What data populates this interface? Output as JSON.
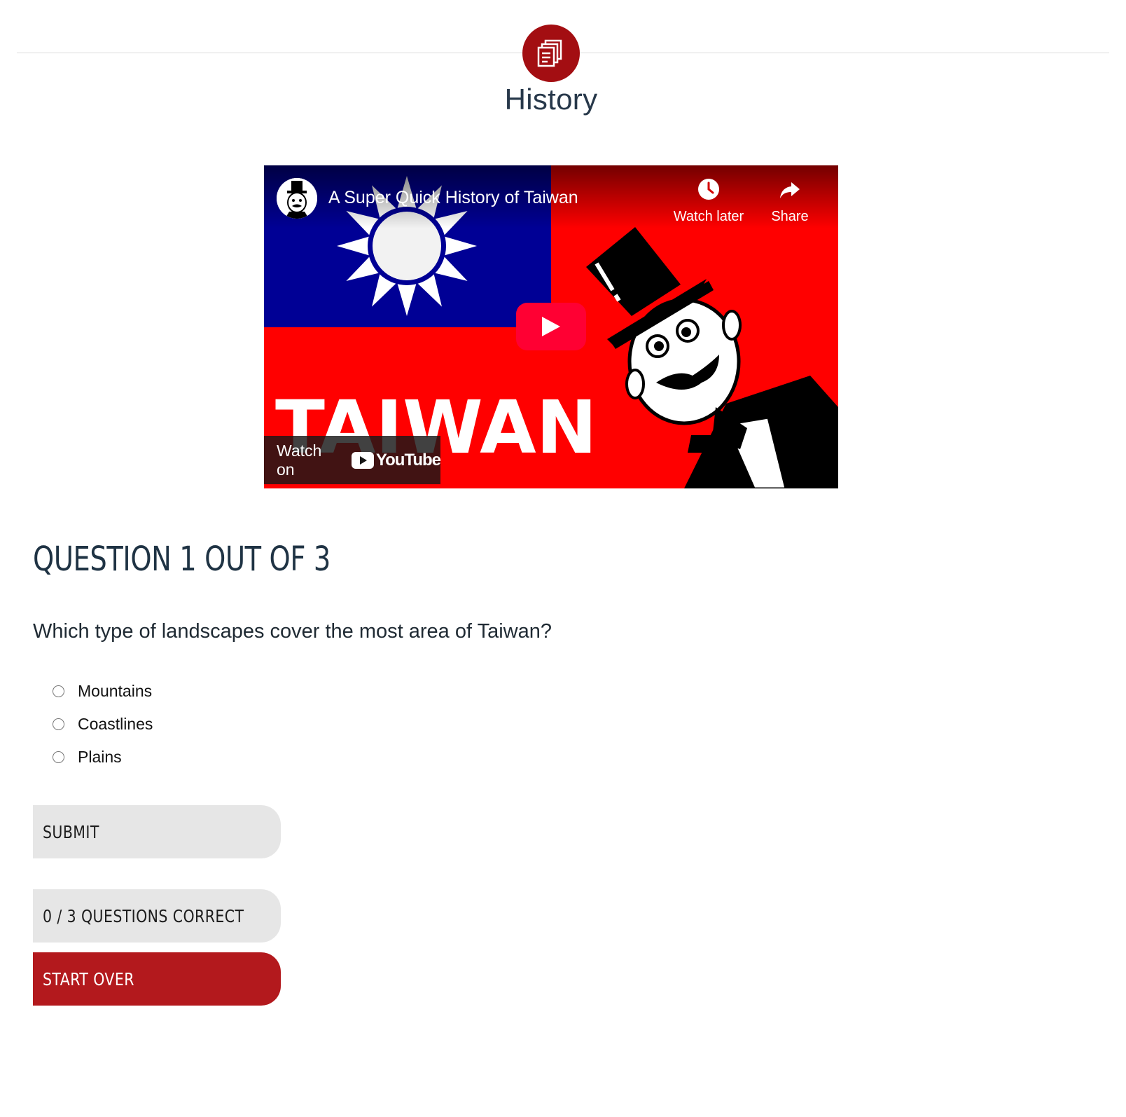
{
  "header": {
    "icon": "stacked-documents-icon",
    "title": "History",
    "accent_color": "#a30e12"
  },
  "video": {
    "title": "A Super Quick History of Taiwan",
    "thumbnail_text": "TAIWAN",
    "actions": [
      {
        "icon": "clock-icon",
        "label": "Watch later"
      },
      {
        "icon": "share-arrow-icon",
        "label": "Share"
      }
    ],
    "watch_on_label": "Watch on",
    "platform_name": "YouTube",
    "play_color": "#ff0033"
  },
  "quiz": {
    "heading": "QUESTION 1 OUT OF 3",
    "question": "Which type of landscapes cover the most area of Taiwan?",
    "options": [
      "Mountains",
      "Coastlines",
      "Plains"
    ],
    "submit_label": "SUBMIT",
    "score_label": "0 / 3 QUESTIONS CORRECT",
    "start_over_label": "START OVER"
  }
}
